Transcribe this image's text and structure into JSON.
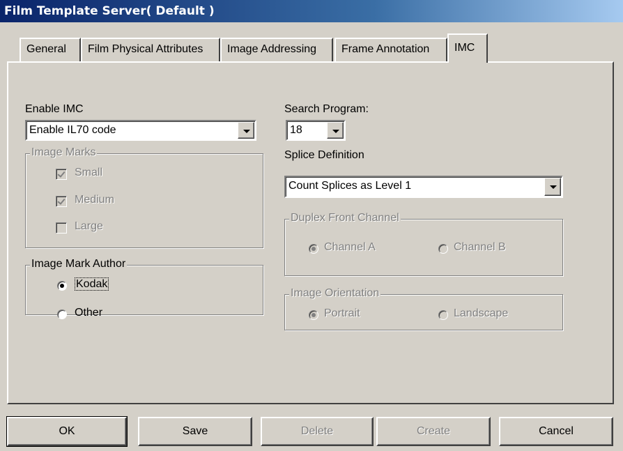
{
  "window": {
    "title": "Film Template Server( Default )"
  },
  "tabs": [
    {
      "label": "General"
    },
    {
      "label": "Film Physical Attributes"
    },
    {
      "label": "Image Addressing"
    },
    {
      "label": "Frame Annotation"
    },
    {
      "label": "IMC",
      "active": true
    }
  ],
  "imc": {
    "enable_label": "Enable IMC",
    "enable_value": "Enable IL70 code",
    "image_marks": {
      "legend": "Image Marks",
      "items": [
        {
          "label": "Small",
          "checked": true
        },
        {
          "label": "Medium",
          "checked": true
        },
        {
          "label": "Large",
          "checked": false
        }
      ]
    },
    "author": {
      "legend": "Image Mark Author",
      "options": [
        {
          "label": "Kodak",
          "selected": true
        },
        {
          "label": "Other",
          "selected": false
        }
      ]
    },
    "search_program_label": "Search Program:",
    "search_program_value": "18",
    "splice_label": "Splice Definition",
    "splice_value": "Count Splices as Level 1",
    "duplex": {
      "legend": "Duplex Front Channel",
      "options": [
        {
          "label": "Channel A",
          "selected": true
        },
        {
          "label": "Channel B",
          "selected": false
        }
      ]
    },
    "orientation": {
      "legend": "Image Orientation",
      "options": [
        {
          "label": "Portrait",
          "selected": true
        },
        {
          "label": "Landscape",
          "selected": false
        }
      ]
    }
  },
  "buttons": {
    "ok": "OK",
    "save": "Save",
    "delete": "Delete",
    "create": "Create",
    "cancel": "Cancel"
  }
}
